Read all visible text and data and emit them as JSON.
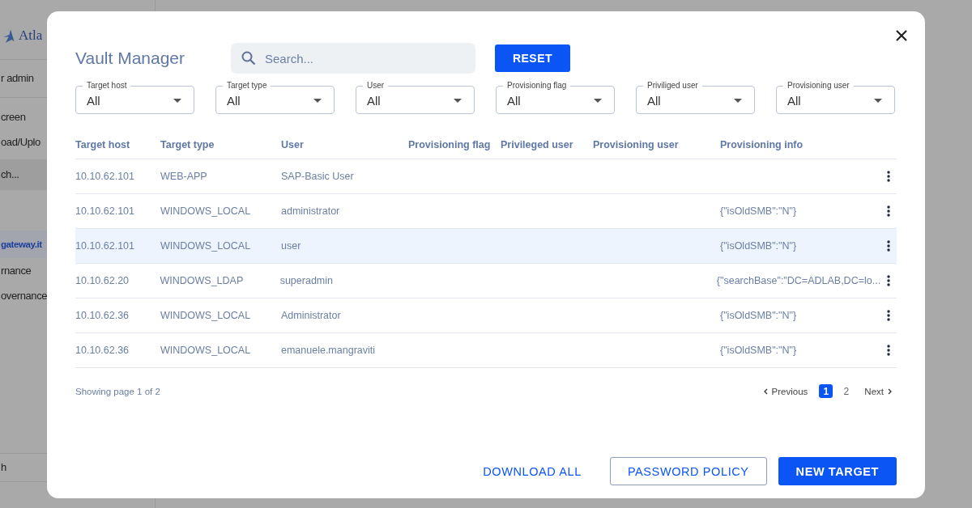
{
  "sidebar": {
    "logo": "Atla",
    "items": [
      {
        "label": "r admin",
        "selected": false
      },
      {
        "label": "creen",
        "selected": false
      },
      {
        "label": "oad/Uplo",
        "selected": false
      },
      {
        "label": "ch...",
        "selected": true
      },
      {
        "label": "gateway.it",
        "selected": true
      },
      {
        "label": "rnance",
        "selected": false
      },
      {
        "label": "overnance",
        "selected": false
      }
    ],
    "bottom_item": "h"
  },
  "dialog": {
    "title": "Vault Manager",
    "search": {
      "placeholder": "Search..."
    },
    "reset_button": "RESET",
    "filters": [
      {
        "label": "Target host",
        "value": "All"
      },
      {
        "label": "Target type",
        "value": "All"
      },
      {
        "label": "User",
        "value": "All"
      },
      {
        "label": "Provisioning flag",
        "value": "All"
      },
      {
        "label": "Priviliged user",
        "value": "All"
      },
      {
        "label": "Provisioning user",
        "value": "All"
      }
    ],
    "table": {
      "columns": [
        "Target host",
        "Target type",
        "User",
        "Provisioning flag",
        "Privileged user",
        "Provisioning user",
        "Provisioning info"
      ],
      "rows": [
        {
          "selected": false,
          "cells": [
            "10.10.62.101",
            "WEB-APP",
            "SAP-Basic User",
            "",
            "",
            "",
            ""
          ]
        },
        {
          "selected": false,
          "cells": [
            "10.10.62.101",
            "WINDOWS_LOCAL",
            "administrator",
            "",
            "",
            "",
            "{\"isOldSMB\":\"N\"}"
          ]
        },
        {
          "selected": true,
          "cells": [
            "10.10.62.101",
            "WINDOWS_LOCAL",
            "user",
            "",
            "",
            "",
            "{\"isOldSMB\":\"N\"}"
          ]
        },
        {
          "selected": false,
          "cells": [
            "10.10.62.20",
            "WINDOWS_LDAP",
            "superadmin",
            "",
            "",
            "",
            "{\"searchBase\":\"DC=ADLAB,DC=lo..."
          ]
        },
        {
          "selected": false,
          "cells": [
            "10.10.62.36",
            "WINDOWS_LOCAL",
            "Administrator",
            "",
            "",
            "",
            "{\"isOldSMB\":\"N\"}"
          ]
        },
        {
          "selected": false,
          "cells": [
            "10.10.62.36",
            "WINDOWS_LOCAL",
            "emanuele.mangraviti",
            "",
            "",
            "",
            "{\"isOldSMB\":\"N\"}"
          ]
        }
      ]
    },
    "page_info": "Showing page 1 of 2",
    "pagination": {
      "previous": "Previous",
      "pages": [
        {
          "label": "1",
          "selected": true
        },
        {
          "label": "2",
          "selected": false
        }
      ],
      "next": "Next"
    },
    "buttons": [
      {
        "label": "DOWNLOAD ALL",
        "kind": "text"
      },
      {
        "label": "PASSWORD POLICY",
        "kind": "outlined"
      },
      {
        "label": "NEW TARGET",
        "kind": "filled"
      }
    ]
  }
}
